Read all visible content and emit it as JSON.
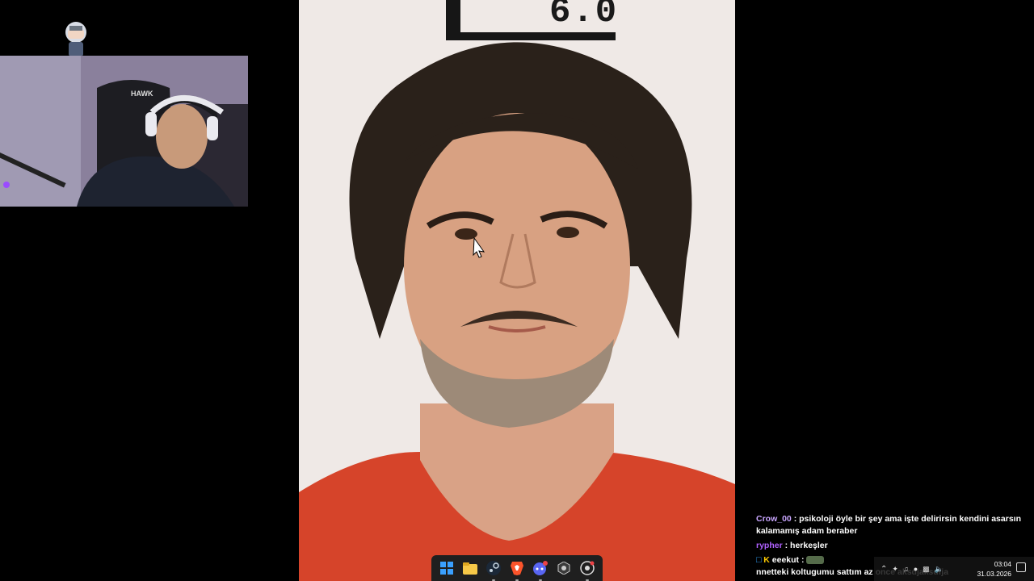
{
  "photo": {
    "board_label": "6.0"
  },
  "chat": {
    "messages": [
      {
        "user": "Crow_00",
        "user_color": "#c9a6ff",
        "separator": " : ",
        "text": "psikoloji öyle bir şey ama işte delirirsin kendini asarsın"
      },
      {
        "user": "",
        "user_color": "#ffffff",
        "separator": "",
        "text": "kalamamış adam beraber"
      },
      {
        "user": "rypher",
        "user_color": "#b061ff",
        "separator": " : ",
        "text": "herkeşler"
      },
      {
        "user": "eeekut",
        "user_color": "#ffffff",
        "separator": " : ",
        "text": "",
        "badges": [
          "K"
        ]
      },
      {
        "user": "",
        "user_color": "#ffffff",
        "separator": "",
        "text": "nnetteki koltugumu sattım az once aksdjaksdfja"
      }
    ]
  },
  "taskbar": {
    "icons": [
      "windows-start-icon",
      "file-explorer-icon",
      "steam-icon",
      "brave-icon",
      "discord-icon",
      "obs-icon",
      "chrome-icon"
    ]
  },
  "tray": {
    "time": "03:04",
    "date": "31.03.2026"
  }
}
